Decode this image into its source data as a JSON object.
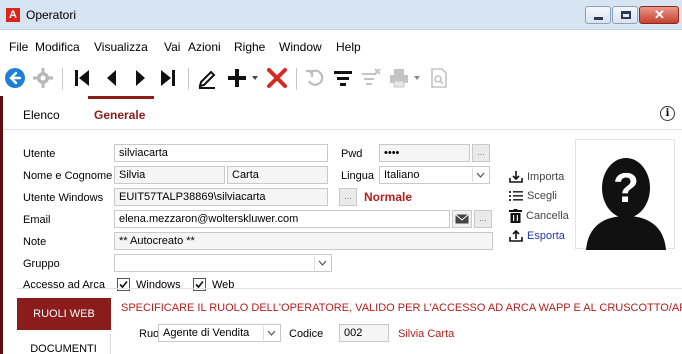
{
  "window": {
    "title": "Operatori",
    "app_icon_letter": "A",
    "close_glyph": "✕"
  },
  "menu": [
    "File",
    "Modifica",
    "Visualizza",
    "Vai",
    "Azioni",
    "Righe",
    "Window",
    "Help"
  ],
  "toolbar_icons": [
    "back-icon",
    "gear-icon",
    "first-record-icon",
    "previous-record-icon",
    "next-record-icon",
    "last-record-icon",
    "edit-icon",
    "add-icon",
    "delete-icon",
    "undo-icon",
    "filter-icon",
    "clear-filter-icon",
    "print-icon",
    "preview-icon"
  ],
  "tabs": {
    "elenco": "Elenco",
    "generale": "Generale"
  },
  "form": {
    "utente_label": "Utente",
    "utente_value": "silviacarta",
    "pwd_label": "Pwd",
    "pwd_value": "••••",
    "nome_label": "Nome e Cognome",
    "nome_value": "Silvia",
    "cognome_value": "Carta",
    "lingua_label": "Lingua",
    "lingua_value": "Italiano",
    "utente_windows_label": "Utente Windows",
    "utente_windows_value": "EUIT57TALP38869\\silviacarta",
    "normale_text": "Normale",
    "email_label": "Email",
    "email_value": "elena.mezzaron@wolterskluwer.com",
    "note_label": "Note",
    "note_value": "** Autocreato **",
    "gruppo_label": "Gruppo",
    "gruppo_value": "",
    "accesso_label": "Accesso ad Arca",
    "windows_label": "Windows",
    "web_label": "Web",
    "dots": "..."
  },
  "actions": {
    "importa": "Importa",
    "scegli": "Scegli",
    "cancella": "Cancella",
    "esporta": "Esporta"
  },
  "bottom": {
    "ruoli_web": "RUOLI WEB",
    "documenti": "DOCUMENTI",
    "notice": "SPECIFICARE IL RUOLO DELL'OPERATORE, VALIDO PER L'ACCESSO AD ARCA WAPP E AL CRUSCOTTO/APP E",
    "ruolo_label": "Ruolo",
    "ruolo_value": "Agente di Vendita",
    "codice_label": "Codice",
    "codice_value": "002",
    "codice_name": "Silvia Carta"
  },
  "colors": {
    "accent": "#8a1c1c",
    "link": "#1e3aa8",
    "back_button": "#1f7fd6"
  }
}
